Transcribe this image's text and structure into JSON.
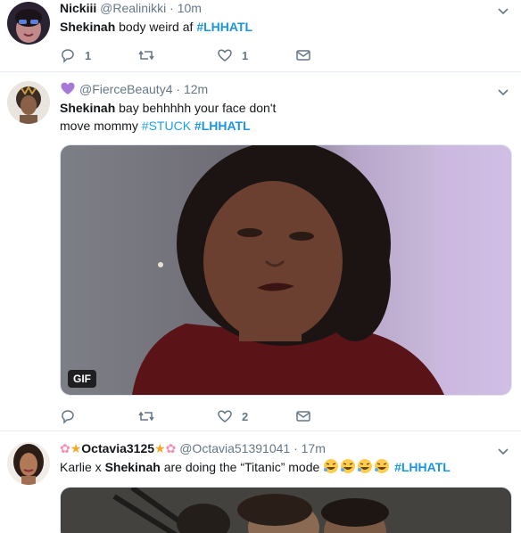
{
  "colors": {
    "link": "#1da1f2",
    "muted": "#657786",
    "text": "#14171a"
  },
  "tweets": [
    {
      "name": "Nickiii",
      "handle": "@Realinikki",
      "time": "10m",
      "text_bold": "Shekinah",
      "text_rest": "body weird af",
      "hashtag": "#LHHATL",
      "reply_count": "1",
      "retweet_count": "",
      "like_count": "1"
    },
    {
      "name_prefix_icon": "purple-heart-icon",
      "handle": "@FierceBeauty4",
      "time": "12m",
      "text_bold": "Shekinah",
      "text_rest_1": "bay behhhhh your face don't",
      "text_rest_2": "move mommy",
      "hashtag_1": "#STUCK",
      "hashtag_2": "#LHHATL",
      "media_badge": "GIF",
      "reply_count": "",
      "retweet_count": "",
      "like_count": "2"
    },
    {
      "name": "Octavia3125",
      "handle": "@Octavia51391041",
      "time": "17m",
      "text_pre": "Karlie x",
      "text_bold": "Shekinah",
      "text_rest": "are doing the  “Titanic” mode",
      "hashtag": "#LHHATL"
    }
  ]
}
